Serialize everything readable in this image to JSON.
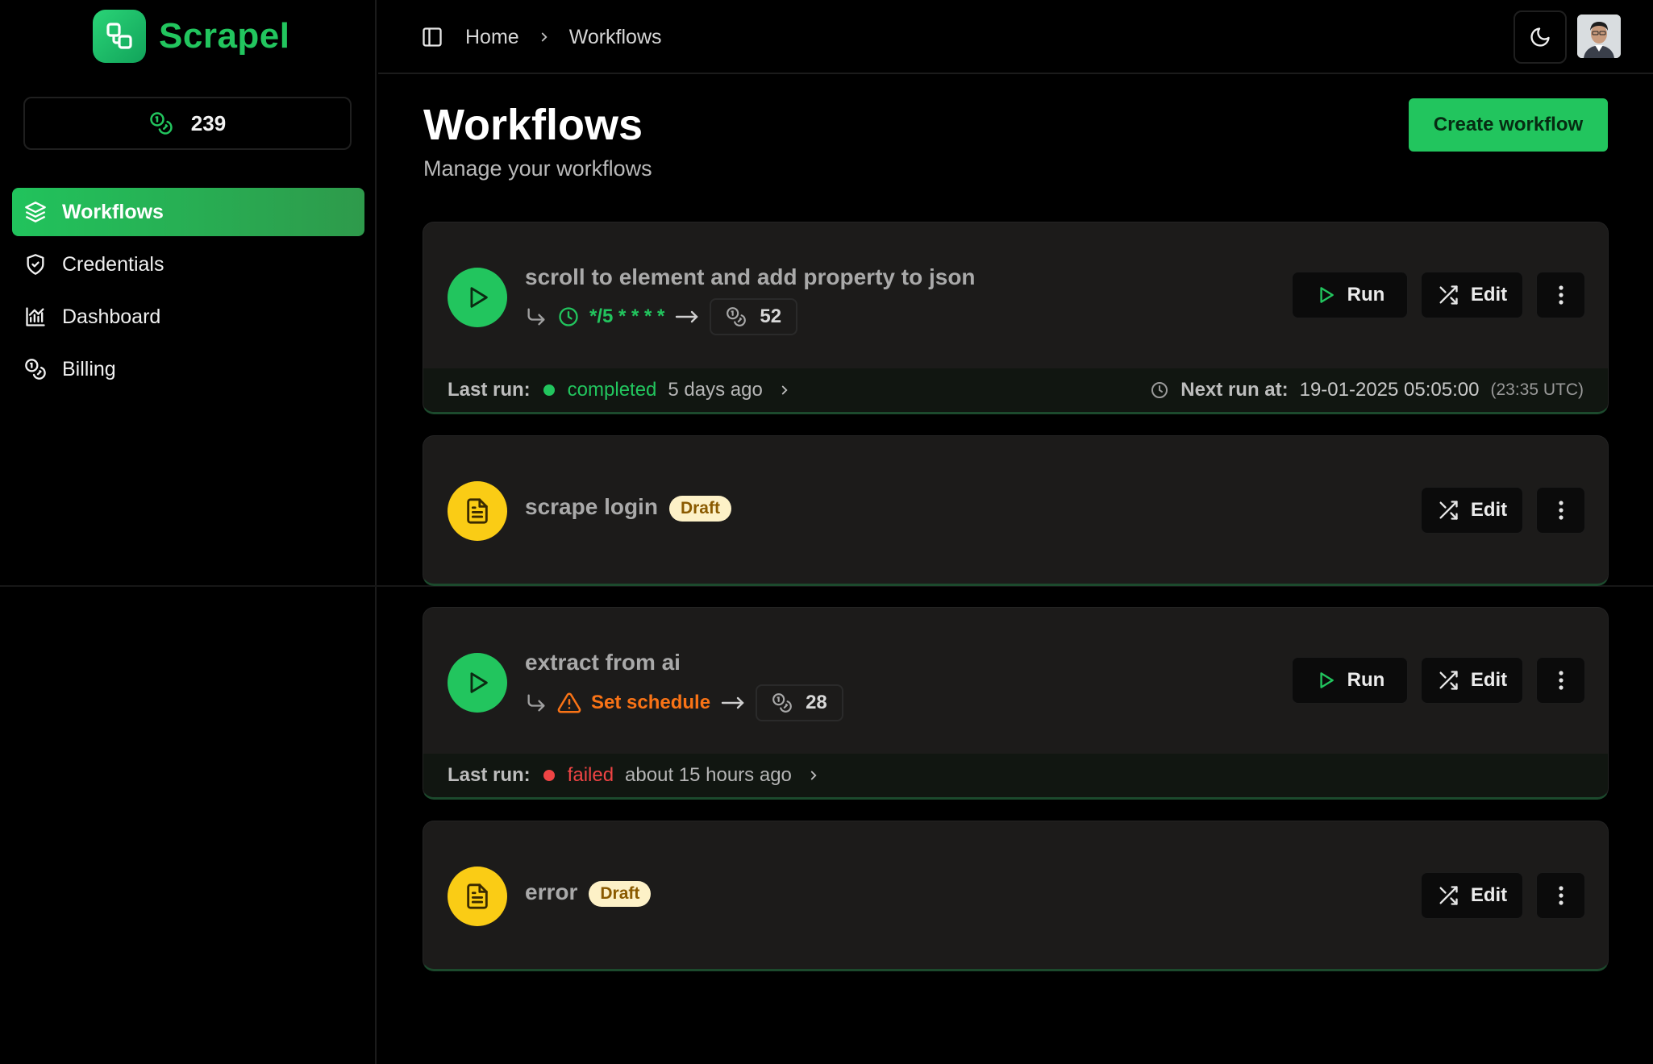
{
  "brand": {
    "name": "Scrapel"
  },
  "sidebar": {
    "credits": "239",
    "items": [
      {
        "label": "Workflows",
        "icon": "layers-icon",
        "active": true
      },
      {
        "label": "Credentials",
        "icon": "shield-icon",
        "active": false
      },
      {
        "label": "Dashboard",
        "icon": "chart-icon",
        "active": false
      },
      {
        "label": "Billing",
        "icon": "coins-icon",
        "active": false
      }
    ]
  },
  "header": {
    "breadcrumb": [
      "Home",
      "Workflows"
    ]
  },
  "page": {
    "title": "Workflows",
    "subtitle": "Manage your workflows",
    "create_label": "Create workflow"
  },
  "buttons": {
    "run": "Run",
    "edit": "Edit"
  },
  "labels": {
    "last_run": "Last run:",
    "next_run": "Next run at:",
    "draft": "Draft"
  },
  "workflows": [
    {
      "name": "scroll to element and add property to json",
      "status": "published",
      "cron": "*/5 * * * *",
      "credits": "52",
      "last_run_status": "completed",
      "last_run_time": "5 days ago",
      "next_run": "19-01-2025 05:05:00",
      "next_run_utc": "(23:35 UTC)"
    },
    {
      "name": "scrape login",
      "status": "draft"
    },
    {
      "name": "extract from ai",
      "status": "published",
      "schedule_label": "Set schedule",
      "credits": "28",
      "last_run_status": "failed",
      "last_run_time": "about 15 hours ago"
    },
    {
      "name": "error",
      "status": "draft"
    }
  ],
  "colors": {
    "accent": "#22c55e",
    "draft_icon": "#facc15",
    "warning": "#f97316",
    "error": "#ef4444",
    "background": "#000000",
    "card": "#1c1b1a"
  }
}
